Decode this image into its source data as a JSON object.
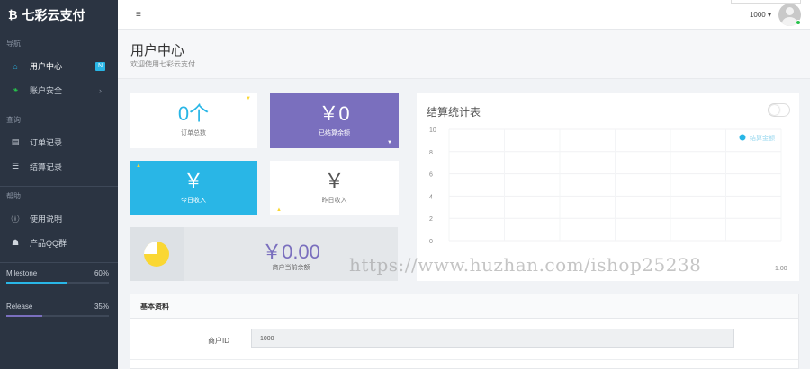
{
  "brand": {
    "icon": "bitcoin-icon",
    "name": "七彩云支付"
  },
  "sidebar": {
    "sections": [
      {
        "title": "导航",
        "items": [
          {
            "label": "用户中心",
            "icon": "home-icon",
            "badge": "N",
            "active": true
          },
          {
            "label": "账户安全",
            "icon": "leaf-icon",
            "chevron": "›"
          }
        ]
      },
      {
        "title": "查询",
        "items": [
          {
            "label": "订单记录",
            "icon": "list-alt-icon"
          },
          {
            "label": "结算记录",
            "icon": "list-icon"
          }
        ]
      },
      {
        "title": "帮助",
        "items": [
          {
            "label": "使用说明",
            "icon": "info-icon"
          },
          {
            "label": "产品QQ群",
            "icon": "user-group-icon"
          }
        ]
      }
    ],
    "progress": [
      {
        "label": "Milestone",
        "value": "60%",
        "fraction": 0.6,
        "color": "#29b6e6"
      },
      {
        "label": "Release",
        "value": "35%",
        "fraction": 0.35,
        "color": "#7a6fbe"
      }
    ]
  },
  "header": {
    "menu_icon": "≡",
    "user_id": "1000 ▾"
  },
  "page": {
    "title": "用户中心",
    "subtitle": "欢迎使用七彩云支付"
  },
  "stats": {
    "orders": {
      "value": "0个",
      "label": "订单总数"
    },
    "settled": {
      "value": "￥0",
      "label": "已结算余额"
    },
    "today": {
      "value": "￥",
      "label": "今日收入"
    },
    "yesterday": {
      "value": "￥",
      "label": "昨日收入"
    },
    "balance": {
      "value": "￥0.00",
      "label": "商户当前余额"
    }
  },
  "chart_data": {
    "type": "line",
    "title": "结算统计表",
    "series": [
      {
        "name": "结算金额",
        "values": []
      }
    ],
    "y_ticks": [
      "10",
      "8",
      "6",
      "4",
      "2",
      "0"
    ],
    "ylim": [
      0,
      10
    ],
    "x_end_label": "1.00",
    "grid": true,
    "legend": "top-right",
    "color": "#29b6e6"
  },
  "watermark": "https://www.huzhan.com/ishop25238",
  "info": {
    "heading": "基本资料",
    "merchant_id_label": "商户ID",
    "merchant_id_value": "1000"
  },
  "colors": {
    "sidebar_bg": "#2b3442",
    "accent_blue": "#29b6e6",
    "accent_purple": "#7a6fbe",
    "accent_yellow": "#fad733"
  }
}
